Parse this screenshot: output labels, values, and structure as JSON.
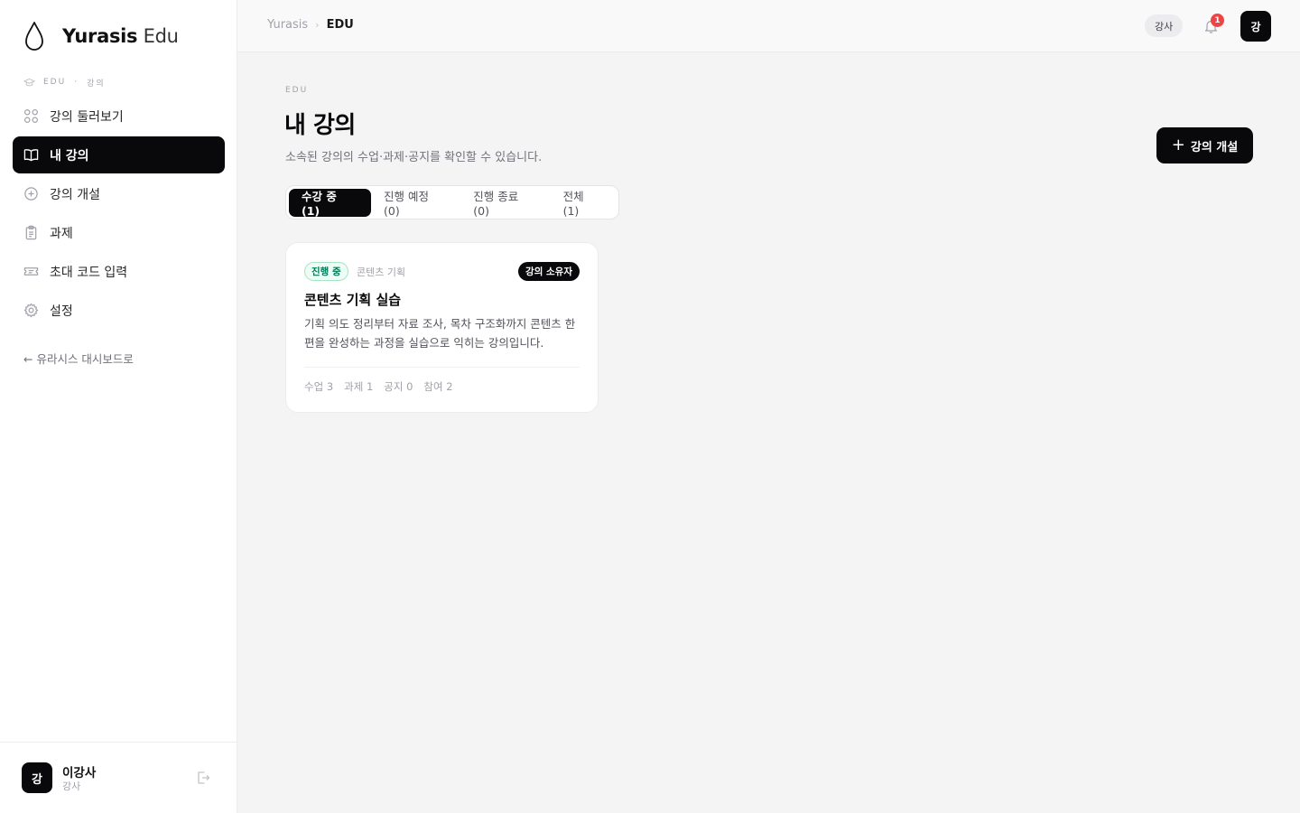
{
  "brand": {
    "name_bold": "Yurasis",
    "name_light": "Edu"
  },
  "sidebar": {
    "section": {
      "left": "EDU",
      "dot": "·",
      "right": "강의"
    },
    "items": [
      {
        "label": "강의 둘러보기",
        "icon": "grid-icon",
        "active": false
      },
      {
        "label": "내 강의",
        "icon": "book-open-icon",
        "active": true
      },
      {
        "label": "강의 개설",
        "icon": "plus-circle-icon",
        "active": false
      },
      {
        "label": "과제",
        "icon": "clipboard-icon",
        "active": false
      },
      {
        "label": "초대 코드 입력",
        "icon": "ticket-icon",
        "active": false
      },
      {
        "label": "설정",
        "icon": "gear-icon",
        "active": false
      }
    ],
    "back_link": "← 유라시스 대시보드로",
    "user": {
      "avatar": "강",
      "name": "이강사",
      "role": "강사"
    }
  },
  "header": {
    "breadcrumb": {
      "root": "Yurasis",
      "separator": "›",
      "current": "EDU"
    },
    "role_pill": "강사",
    "notification_count": "1",
    "avatar": "강"
  },
  "main": {
    "eyebrow": "EDU",
    "title": "내 강의",
    "subtitle": "소속된 강의의 수업·과제·공지를 확인할 수 있습니다.",
    "create_button": {
      "plus": "+",
      "label": "강의 개설"
    },
    "tabs": [
      {
        "label": "수강 중 (1)",
        "active": true
      },
      {
        "label": "진행 예정 (0)",
        "active": false
      },
      {
        "label": "진행 종료 (0)",
        "active": false
      },
      {
        "label": "전체 (1)",
        "active": false
      }
    ],
    "courses": [
      {
        "status": "진행 중",
        "category": "콘텐츠 기획",
        "owner_badge": "강의 소유자",
        "title": "콘텐츠 기획 실습",
        "description": "기획 의도 정리부터 자료 조사, 목차 구조화까지 콘텐츠 한 편을 완성하는 과정을 실습으로 익히는 강의입니다.",
        "stats": {
          "lessons": "수업 3",
          "assignments": "과제 1",
          "notices": "공지 0",
          "participants": "참여 2"
        }
      }
    ]
  },
  "colors": {
    "primary": "#09090b",
    "status_green": "#047857",
    "badge_red": "#ef4444"
  }
}
